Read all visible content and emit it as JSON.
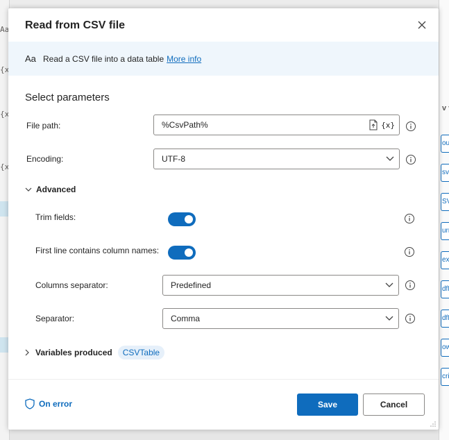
{
  "dialog": {
    "title": "Read from CSV file",
    "info_text": "Read a CSV file into a data table",
    "info_link": "More info",
    "info_icon_text": "Aa",
    "section_title": "Select parameters"
  },
  "fields": {
    "file_path": {
      "label": "File path:",
      "value": "%CsvPath%",
      "var_button": "{x}"
    },
    "encoding": {
      "label": "Encoding:",
      "value": "UTF-8"
    }
  },
  "advanced": {
    "label": "Advanced",
    "trim_fields": {
      "label": "Trim fields:",
      "on": true
    },
    "first_line_headers": {
      "label": "First line contains column names:",
      "on": true
    },
    "columns_separator": {
      "label": "Columns separator:",
      "value": "Predefined"
    },
    "separator": {
      "label": "Separator:",
      "value": "Comma"
    }
  },
  "variables": {
    "label": "Variables produced",
    "items": [
      "CSVTable"
    ]
  },
  "footer": {
    "on_error": "On error",
    "save": "Save",
    "cancel": "Cancel"
  },
  "background": {
    "left_fragments": [
      "Aa",
      "{x",
      "{x",
      "{x"
    ],
    "right_header": "v v",
    "right_items": [
      "ouri",
      "svP",
      "SVT",
      "urre",
      "extS",
      "dfFi",
      "dfFi",
      "owe",
      "cript"
    ]
  },
  "colors": {
    "accent": "#0f6cbd",
    "info_bar": "#eff6fc",
    "pill_bg": "#e6f0fa"
  }
}
